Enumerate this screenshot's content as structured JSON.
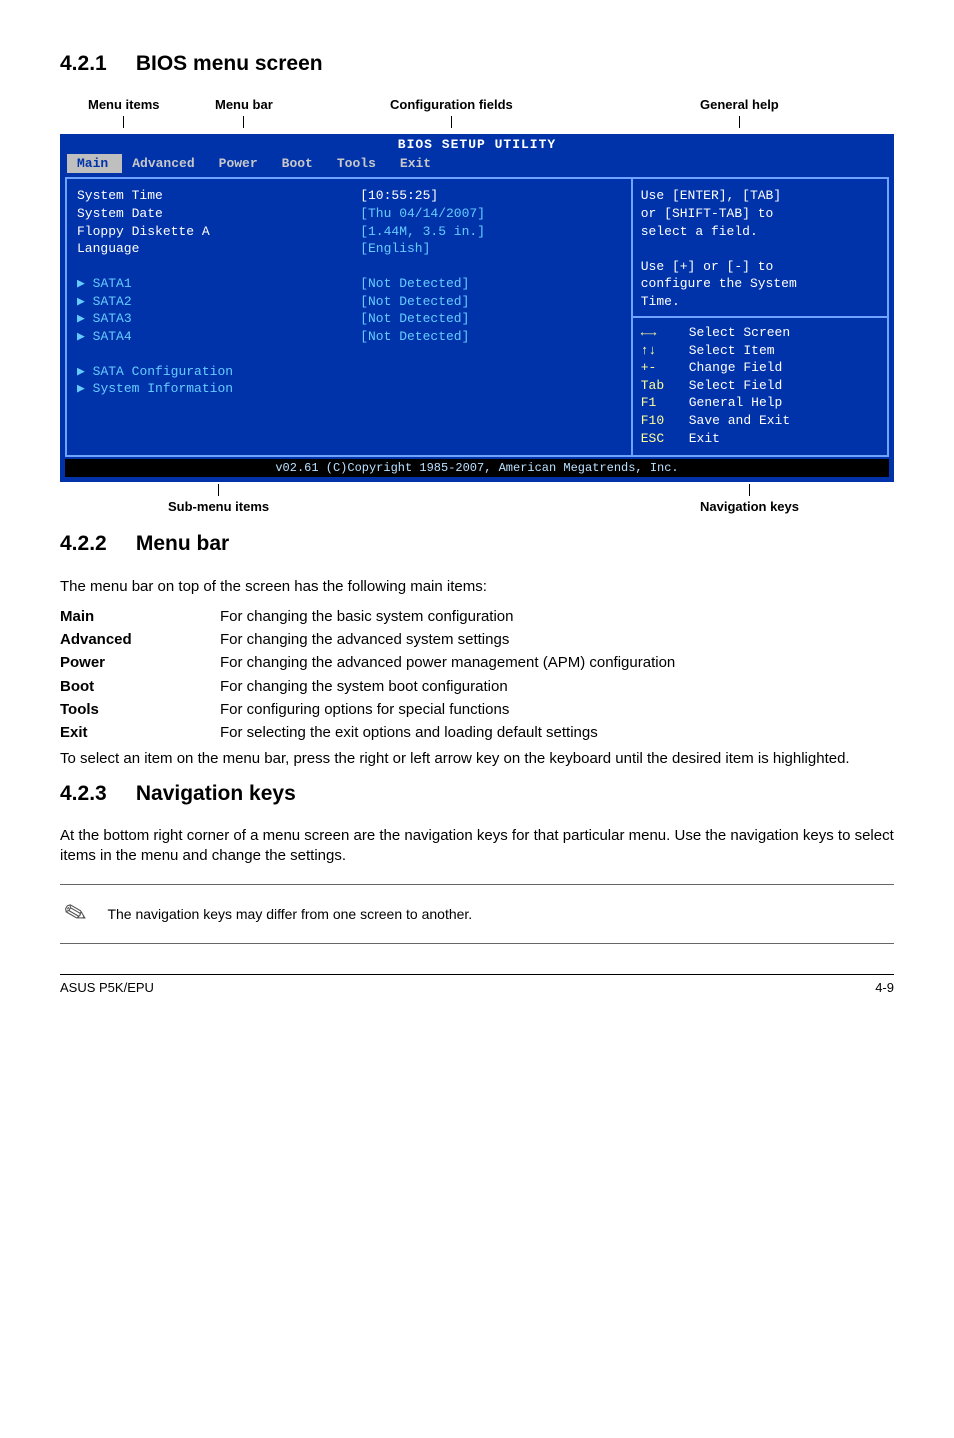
{
  "sec421": {
    "num": "4.2.1",
    "title": "BIOS menu screen"
  },
  "labels": {
    "menuitems": "Menu items",
    "menubar": "Menu bar",
    "config": "Configuration fields",
    "genhelp": "General help",
    "submenu": "Sub-menu items",
    "navkeys": "Navigation keys"
  },
  "bios": {
    "title": "BIOS SETUP UTILITY",
    "tabs": [
      "Main",
      "Advanced",
      "Power",
      "Boot",
      "Tools",
      "Exit"
    ],
    "left_block1": [
      "System Time",
      "System Date",
      "Floppy Diskette A",
      "Language"
    ],
    "left_block2": [
      "SATA1",
      "SATA2",
      "SATA3",
      "SATA4"
    ],
    "left_block3": [
      "SATA Configuration",
      "System Information"
    ],
    "mid_block1": [
      "[10:55:25]",
      "[Thu 04/14/2007]",
      "[1.44M, 3.5 in.]",
      "[English]"
    ],
    "mid_block2": [
      "[Not Detected]",
      "[Not Detected]",
      "[Not Detected]",
      "[Not Detected]"
    ],
    "right_top": [
      "Use [ENTER], [TAB]",
      "or [SHIFT-TAB] to",
      "select a field.",
      "",
      "Use [+] or [-] to",
      "configure the System",
      "Time."
    ],
    "right_bottom": [
      {
        "k": "←→",
        "v": "Select Screen"
      },
      {
        "k": "↑↓",
        "v": "Select Item"
      },
      {
        "k": "+-",
        "v": "Change Field"
      },
      {
        "k": "Tab",
        "v": "Select Field"
      },
      {
        "k": "F1",
        "v": "General Help"
      },
      {
        "k": "F10",
        "v": "Save and Exit"
      },
      {
        "k": "ESC",
        "v": "Exit"
      }
    ],
    "footer": "v02.61 (C)Copyright 1985-2007, American Megatrends, Inc."
  },
  "sec422": {
    "num": "4.2.2",
    "title": "Menu bar",
    "intro": "The menu bar on top of the screen has the following main items:",
    "rows": [
      {
        "term": "Main",
        "def": "For changing the basic system configuration"
      },
      {
        "term": "Advanced",
        "def": "For changing the advanced system settings"
      },
      {
        "term": "Power",
        "def": "For changing the advanced power management (APM) configuration"
      },
      {
        "term": "Boot",
        "def": "For changing the system boot configuration"
      },
      {
        "term": "Tools",
        "def": "For configuring options for special functions"
      },
      {
        "term": "Exit",
        "def": "For selecting the exit options and loading default settings"
      }
    ],
    "outro": "To select an item on the menu bar, press the right or left arrow key on the keyboard until the desired item is highlighted."
  },
  "sec423": {
    "num": "4.2.3",
    "title": "Navigation keys",
    "para": "At the bottom right corner of a menu screen are the navigation keys for that particular menu. Use the navigation keys to select items in the menu and change the settings."
  },
  "note": "The navigation keys may differ from one screen to another.",
  "footer": {
    "left": "ASUS P5K/EPU",
    "right": "4-9"
  }
}
